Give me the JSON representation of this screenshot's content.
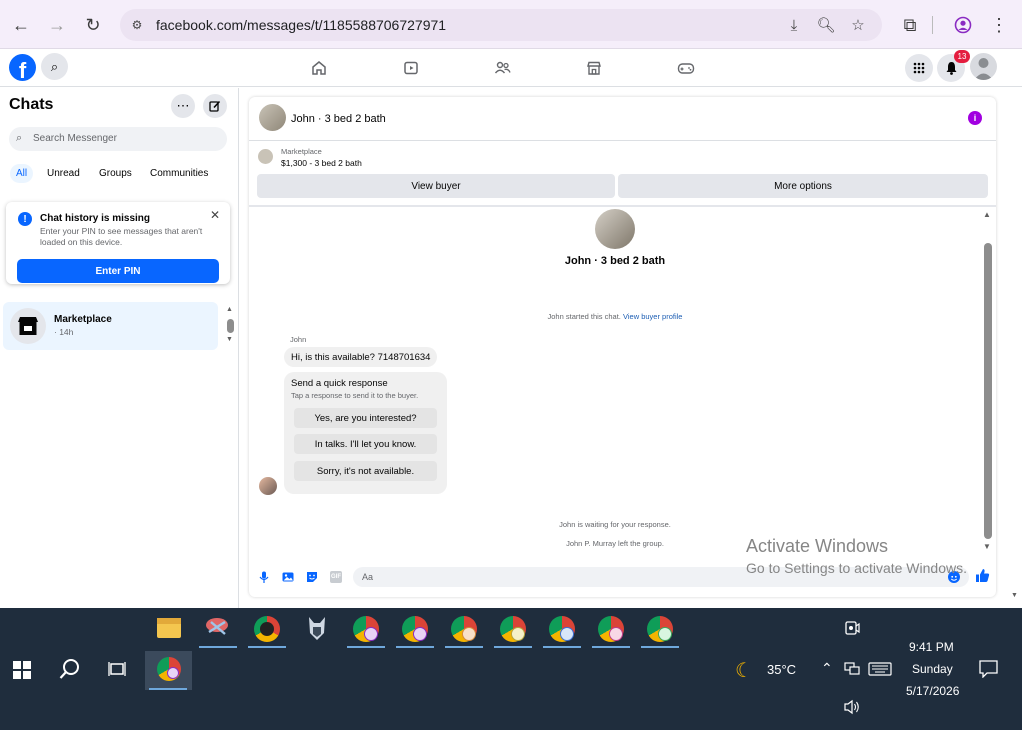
{
  "browser": {
    "url": "facebook.com/messages/t/1185588706727971"
  },
  "fb": {
    "logo": "f",
    "notification_count": "13"
  },
  "sidebar": {
    "title": "Chats",
    "search_placeholder": "Search Messenger",
    "filters": [
      "All",
      "Unread",
      "Groups",
      "Communities"
    ],
    "active_filter": "All",
    "card": {
      "title": "Chat history is missing",
      "body": "Enter your PIN to see messages that aren't loaded on this device.",
      "button": "Enter PIN"
    },
    "conversations": [
      {
        "name": "Marketplace",
        "time": "· 14h"
      }
    ]
  },
  "chat": {
    "header_name": "John · 3 bed 2 bath",
    "marketplace_label": "Marketplace",
    "listing": "$1,300 - 3 bed 2 bath",
    "view_buyer": "View buyer",
    "more_options": "More options",
    "center_name": "John · 3 bed 2 bath",
    "started_text": "John started this chat.",
    "started_link": "View buyer profile",
    "sender": "John",
    "message": "Hi, is this available? 7148701634",
    "quick_title": "Send a quick response",
    "quick_sub": "Tap a response to send it to the buyer.",
    "quick_options": [
      "Yes, are you interested?",
      "In talks. I'll let you know.",
      "Sorry, it's not available."
    ],
    "waiting_text": "John is waiting for your response.",
    "left_text": "John P. Murray left the group.",
    "composer_placeholder": "Aa"
  },
  "watermark": {
    "title": "Activate Windows",
    "subtitle": "Go to Settings to activate Windows."
  },
  "taskbar": {
    "temperature": "35°C",
    "time": "9:41 PM",
    "day": "Sunday",
    "date": "5/17/2026"
  },
  "colors": {
    "fb_blue": "#0866ff",
    "taskbar": "#1f2d3d",
    "chrome_bg": "#f5eefa"
  }
}
